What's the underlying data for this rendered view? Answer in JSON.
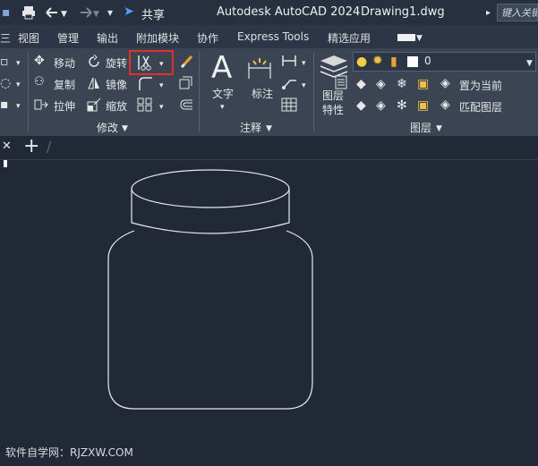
{
  "app": {
    "title": "Autodesk AutoCAD 2024",
    "file": "Drawing1.dwg",
    "share": "共享",
    "search_placeholder": "键入关键"
  },
  "menu": [
    "视图",
    "管理",
    "输出",
    "附加模块",
    "协作",
    "Express Tools",
    "精选应用"
  ],
  "modify": {
    "move": "移动",
    "rotate": "旋转",
    "copy": "复制",
    "mirror": "镜像",
    "stretch": "拉伸",
    "scale": "缩放",
    "group_label": "修改"
  },
  "annotation": {
    "text": "文字",
    "dimension": "标注",
    "group_label": "注释"
  },
  "layers": {
    "layer_props": "图层",
    "layer_props2": "特性",
    "current_layer": "0",
    "set_current": "置为当前",
    "match_layer": "匹配图层",
    "group_label": "图层"
  },
  "watermark": "软件自学网：RJZXW.COM",
  "colors": {
    "highlight": "#e0302a",
    "canvas": "#222936",
    "ribbon": "#3a4453"
  }
}
